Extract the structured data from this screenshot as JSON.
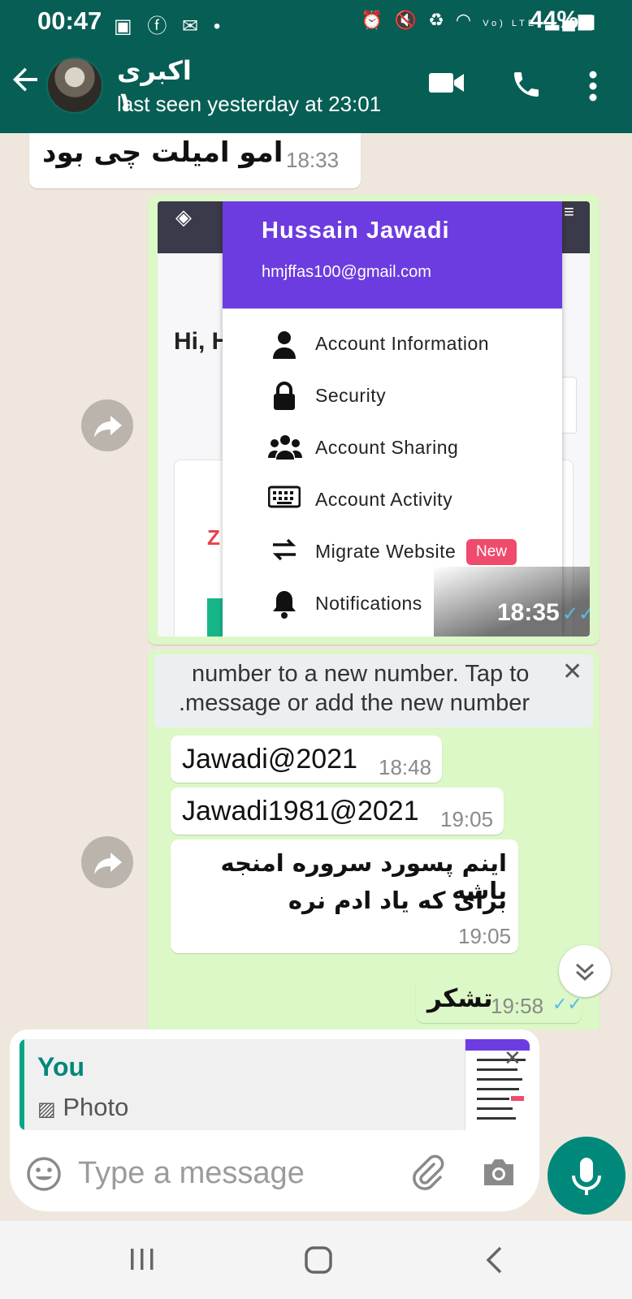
{
  "status_bar": {
    "time": "00:47",
    "battery": "44%",
    "network": "Vo) LTE"
  },
  "header": {
    "contact_name": "اکبری ۱",
    "last_seen": "last seen yesterday at 23:01"
  },
  "messages": {
    "m1": {
      "text": "امو امیلت چی بود",
      "time": "18:33"
    },
    "photo": {
      "time": "18:35",
      "screenshot": {
        "partial_greeting": "Hi, H",
        "partial_logo": "Z",
        "user_name": "Hussain Jawadi",
        "user_email": "hmjffas100@gmail.com",
        "menu_items": [
          {
            "label": "Account Information",
            "icon": "person-icon"
          },
          {
            "label": "Security",
            "icon": "lock-icon"
          },
          {
            "label": "Account Sharing",
            "icon": "group-icon"
          },
          {
            "label": "Account Activity",
            "icon": "keyboard-icon"
          },
          {
            "label": "Migrate Website",
            "icon": "swap-icon",
            "badge": "New"
          },
          {
            "label": "Notifications",
            "icon": "bell-icon"
          }
        ]
      }
    },
    "forwarded_block": {
      "banner_line1": "number to a new number. Tap to",
      "banner_line2": ".message or add the new number",
      "m2": {
        "text": "Jawadi@2021",
        "time": "18:48"
      },
      "m3": {
        "text": "Jawadi1981@2021",
        "time": "19:05"
      },
      "m4": {
        "line1": "اینم پسورد سروره امنجه باشه",
        "line2": "برای که یاد ادم نره",
        "time": "19:05"
      }
    },
    "m5": {
      "text": "تشکر",
      "time": "19:58"
    }
  },
  "reply": {
    "author": "You",
    "type_label": "Photo"
  },
  "composer": {
    "placeholder": "Type a message"
  },
  "colors": {
    "header": "#075e54",
    "outgoing_bubble": "#dcf8c6",
    "accent": "#00897b",
    "menu_header": "#6c3ce0",
    "badge": "#ef4b6c",
    "read_check": "#53bdeb"
  }
}
